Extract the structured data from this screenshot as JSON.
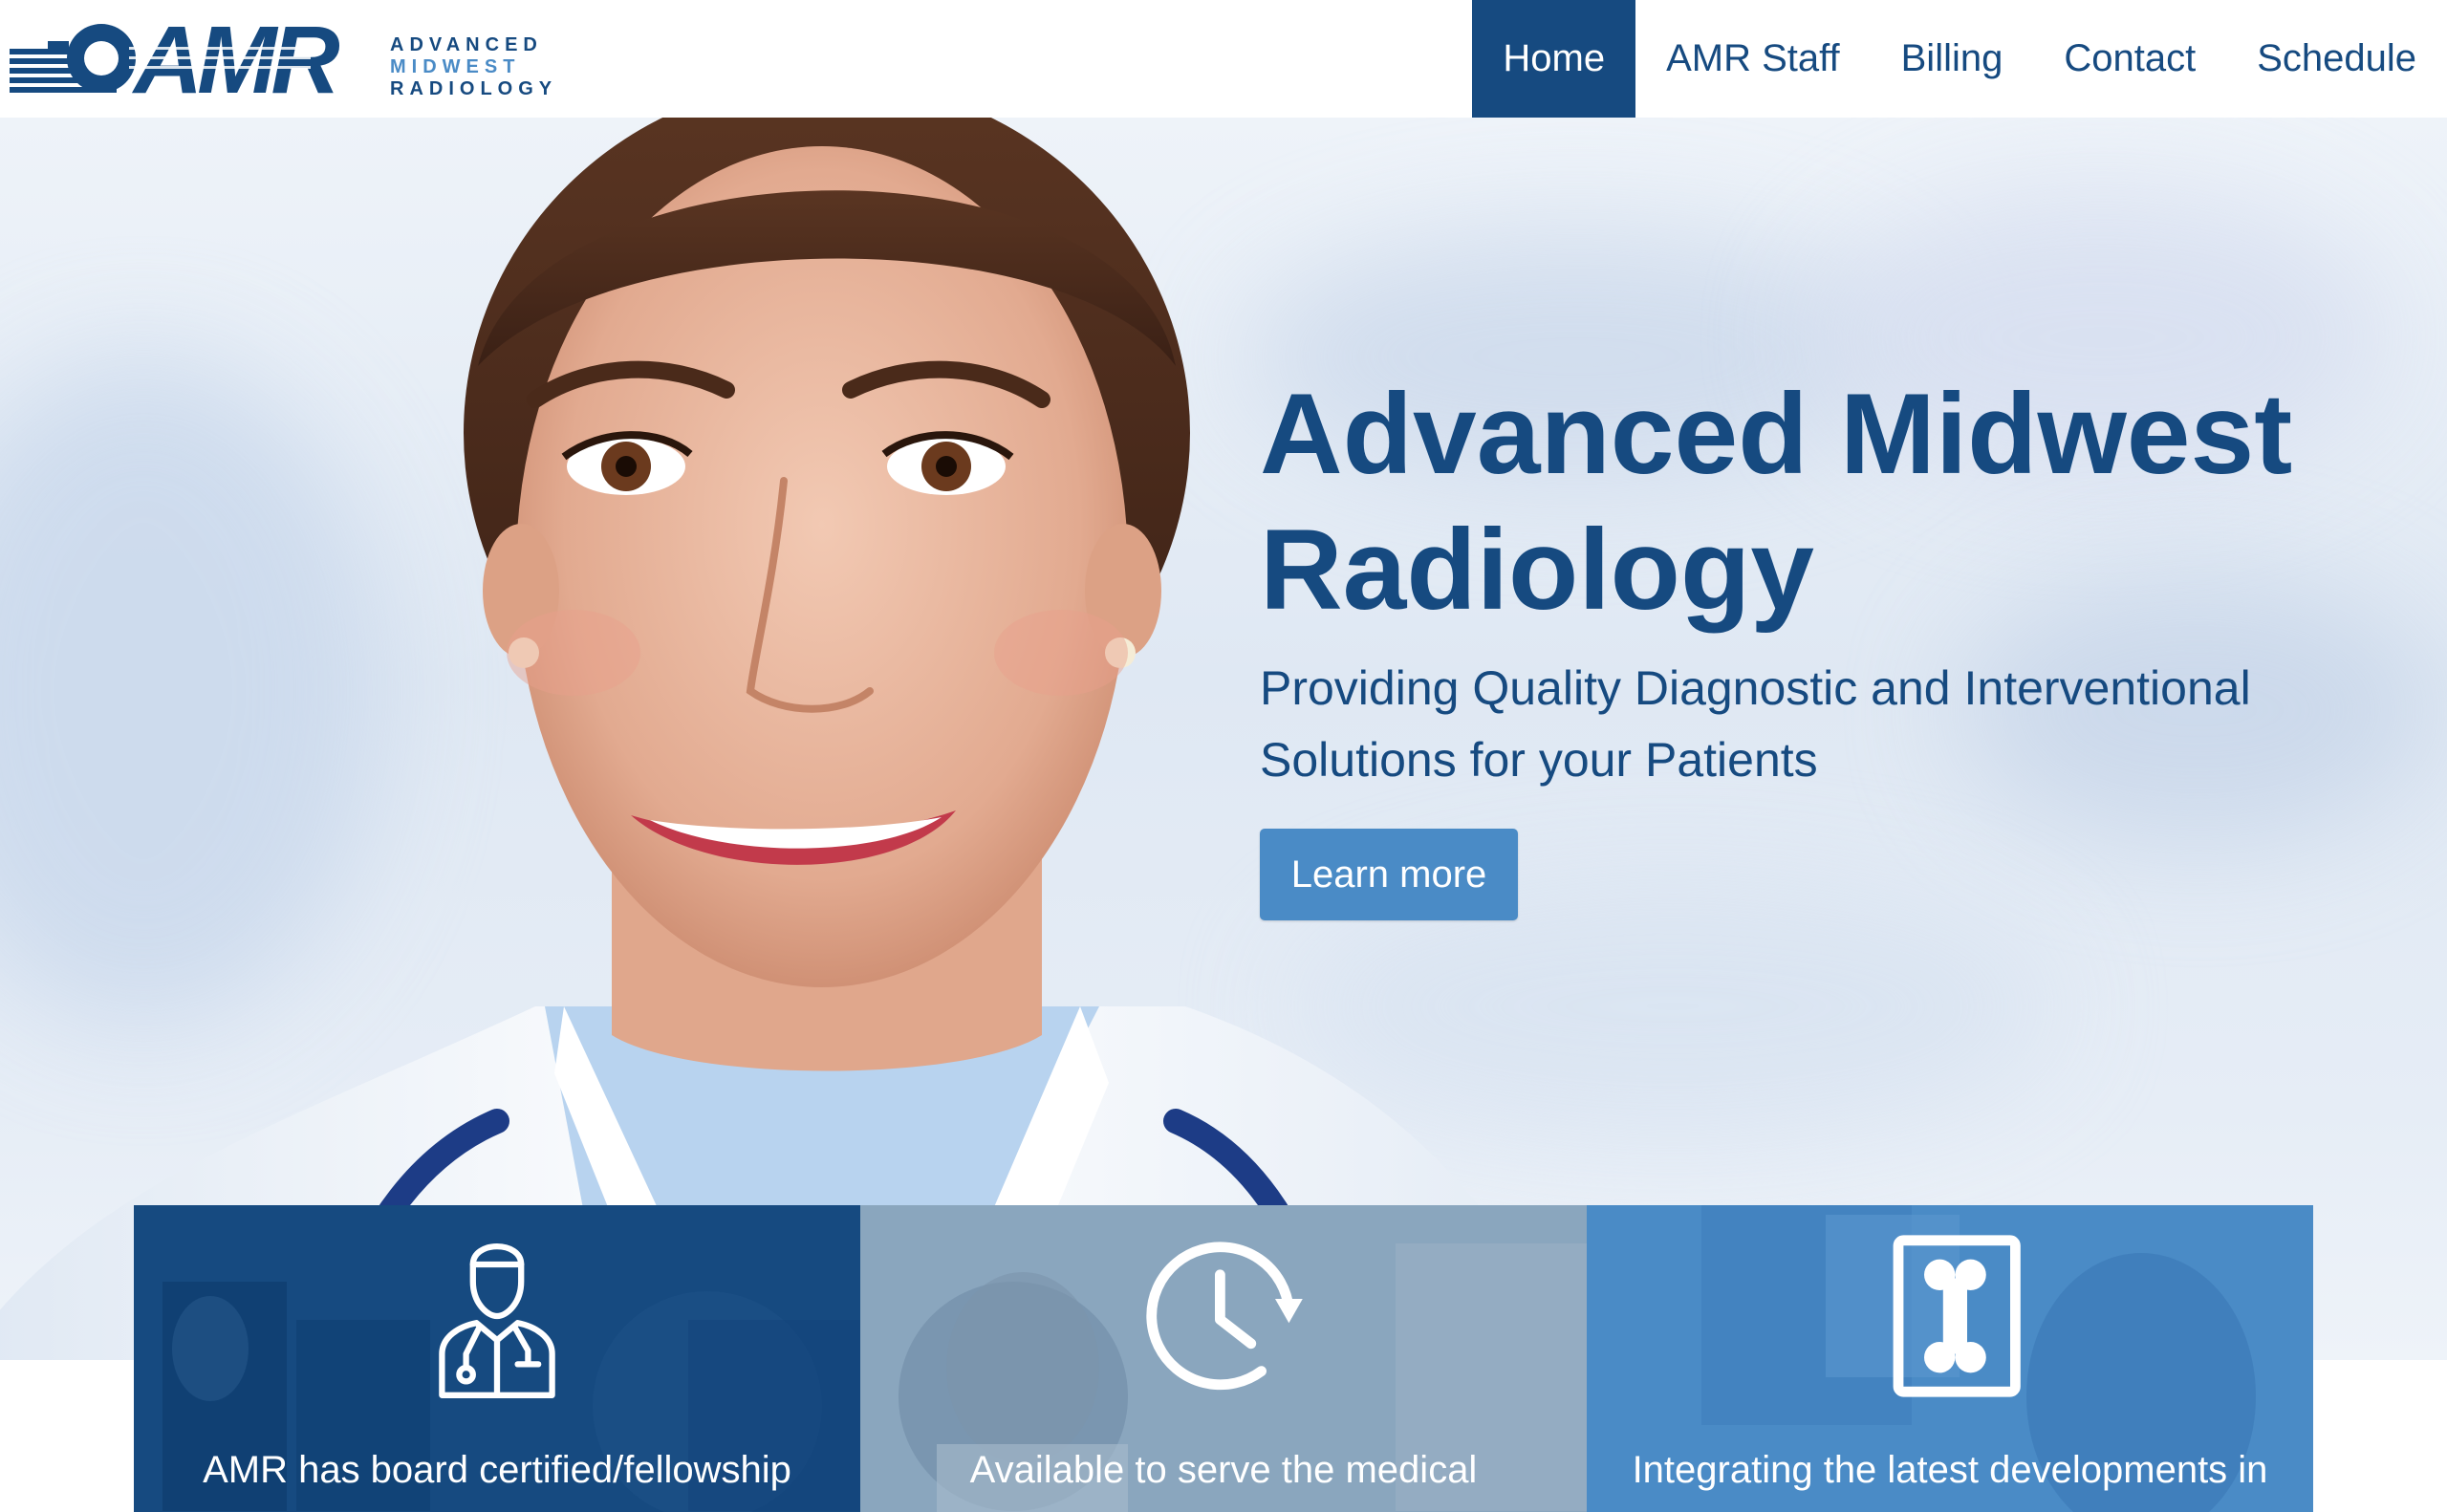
{
  "brand": {
    "logo_text": "AMR",
    "tagline_lines": [
      "ADVANCED",
      "MIDWEST",
      "RADIOLOGY"
    ],
    "primary_color": "#164a80",
    "accent_color": "#4a8bc6"
  },
  "nav": {
    "items": [
      {
        "label": "Home",
        "active": true
      },
      {
        "label": "AMR Staff",
        "active": false
      },
      {
        "label": "Billing",
        "active": false
      },
      {
        "label": "Contact",
        "active": false
      },
      {
        "label": "Schedule",
        "active": false
      }
    ]
  },
  "hero": {
    "title": "Advanced Midwest Radiology",
    "subtitle": "Providing Quality Diagnostic and Interventional Solutions for your Patients",
    "button_label": "Learn more"
  },
  "features": [
    {
      "icon": "doctor-icon",
      "text": "AMR has board certified/fellowship"
    },
    {
      "icon": "clock-icon",
      "text": "Available to serve the medical"
    },
    {
      "icon": "xray-bone-icon",
      "text": "Integrating the latest developments in"
    }
  ]
}
